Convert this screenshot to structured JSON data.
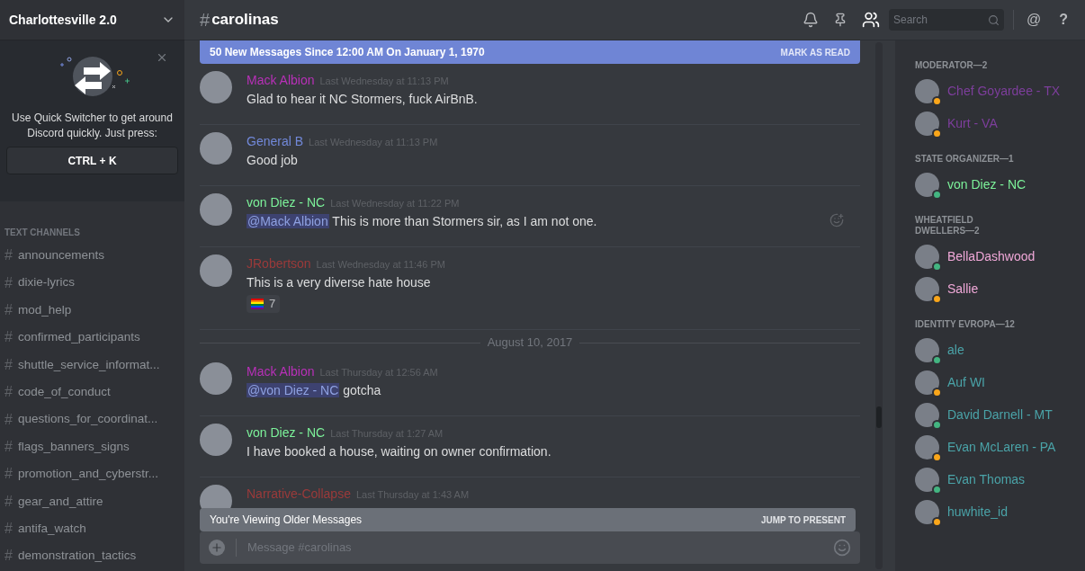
{
  "server": {
    "name": "Charlottesville 2.0"
  },
  "quick_switcher": {
    "text": "Use Quick Switcher to get around Discord quickly. Just press:",
    "shortcut": "CTRL + K"
  },
  "channels": {
    "heading": "TEXT CHANNELS",
    "hash": "#",
    "items": [
      {
        "name": "announcements",
        "selected": false
      },
      {
        "name": "dixie-lyrics",
        "selected": false
      },
      {
        "name": "mod_help",
        "selected": false
      },
      {
        "name": "confirmed_participants",
        "selected": false
      },
      {
        "name": "shuttle_service_informat...",
        "selected": false
      },
      {
        "name": "code_of_conduct",
        "selected": false
      },
      {
        "name": "questions_for_coordinat...",
        "selected": false
      },
      {
        "name": "flags_banners_signs",
        "selected": false
      },
      {
        "name": "promotion_and_cyberstr...",
        "selected": false
      },
      {
        "name": "gear_and_attire",
        "selected": false
      },
      {
        "name": "antifa_watch",
        "selected": false
      },
      {
        "name": "demonstration_tactics",
        "selected": false
      }
    ]
  },
  "header": {
    "hash": "#",
    "channel": "carolinas",
    "search_placeholder": "Search",
    "at": "@",
    "help": "?"
  },
  "new_messages_bar": {
    "text": "50 New Messages Since 12:00 AM On January 1, 1970",
    "action": "MARK AS READ"
  },
  "messages": [
    {
      "kind": "message",
      "author": "Mack Albion",
      "color": "#b830b8",
      "time": "Last Wednesday at 11:13 PM",
      "body": [
        {
          "kind": "text",
          "text": "Glad to hear it NC Stormers, fuck AirBnB."
        }
      ]
    },
    {
      "kind": "message",
      "author": "General B",
      "color": "#7289da",
      "time": "Last Wednesday at 11:13 PM",
      "body": [
        {
          "kind": "text",
          "text": "Good job"
        }
      ]
    },
    {
      "kind": "message",
      "author": "von Diez - NC",
      "color": "#7cf29a",
      "time": "Last Wednesday at 11:22 PM",
      "body": [
        {
          "kind": "mention",
          "text": "@Mack Albion"
        },
        {
          "kind": "text",
          "text": " This is more than Stormers sir, as I am not one."
        }
      ],
      "add_reaction": true
    },
    {
      "kind": "message",
      "author": "JRobertson",
      "color": "#9b3a3a",
      "time": "Last Wednesday at 11:46 PM",
      "body": [
        {
          "kind": "text",
          "text": "This is a very diverse hate house"
        }
      ],
      "reactions": [
        {
          "count": "7"
        }
      ]
    },
    {
      "kind": "divider",
      "text": "August 10, 2017"
    },
    {
      "kind": "message",
      "author": "Mack Albion",
      "color": "#b830b8",
      "time": "Last Thursday at 12:56 AM",
      "body": [
        {
          "kind": "mention",
          "text": "@von Diez - NC"
        },
        {
          "kind": "text",
          "text": " gotcha"
        }
      ]
    },
    {
      "kind": "message",
      "author": "von Diez - NC",
      "color": "#7cf29a",
      "time": "Last Thursday at 1:27 AM",
      "body": [
        {
          "kind": "text",
          "text": "I have booked a house, waiting on owner confirmation."
        }
      ]
    },
    {
      "kind": "message",
      "author": "Narrative-Collapse",
      "color": "#9b3a3a",
      "time": "Last Thursday at 1:43 AM"
    }
  ],
  "older_bar": {
    "text": "You're Viewing Older Messages",
    "action": "JUMP TO PRESENT"
  },
  "composer": {
    "placeholder": "Message #carolinas"
  },
  "members": [
    {
      "heading": "MODERATOR—2",
      "items": [
        {
          "name": "Chef Goyardee - TX",
          "color": "#7d3e9c",
          "status": {
            "color": "#faa61a"
          }
        },
        {
          "name": "Kurt - VA",
          "color": "#7d3e9c",
          "status": {
            "color": "#faa61a"
          }
        }
      ]
    },
    {
      "heading": "STATE ORGANIZER—1",
      "items": [
        {
          "name": "von Diez - NC",
          "color": "#7cf29a",
          "status": {
            "color": "#43b581"
          }
        }
      ]
    },
    {
      "heading": "WHEATFIELD DWELLERS—2",
      "items": [
        {
          "name": "BellaDashwood",
          "color": "#f0a8d8",
          "status": {
            "color": "#43b581"
          }
        },
        {
          "name": "Sallie",
          "color": "#f0a8d8",
          "status": {
            "color": "#faa61a"
          }
        }
      ]
    },
    {
      "heading": "IDENTITY EVROPA—12",
      "items": [
        {
          "name": "ale",
          "color": "#4aa3a8",
          "status": {
            "color": "#43b581"
          }
        },
        {
          "name": "Auf WI",
          "color": "#4aa3a8",
          "status": {
            "color": "#faa61a"
          }
        },
        {
          "name": "David Darnell - MT",
          "color": "#4aa3a8",
          "status": {
            "color": "#43b581"
          }
        },
        {
          "name": "Evan McLaren - PA",
          "color": "#4aa3a8",
          "status": {
            "color": "#faa61a"
          }
        },
        {
          "name": "Evan Thomas",
          "color": "#4aa3a8",
          "status": {
            "color": "#43b581"
          }
        },
        {
          "name": "huwhite_id",
          "color": "#4aa3a8",
          "status": {
            "color": "#faa61a"
          }
        }
      ]
    }
  ]
}
